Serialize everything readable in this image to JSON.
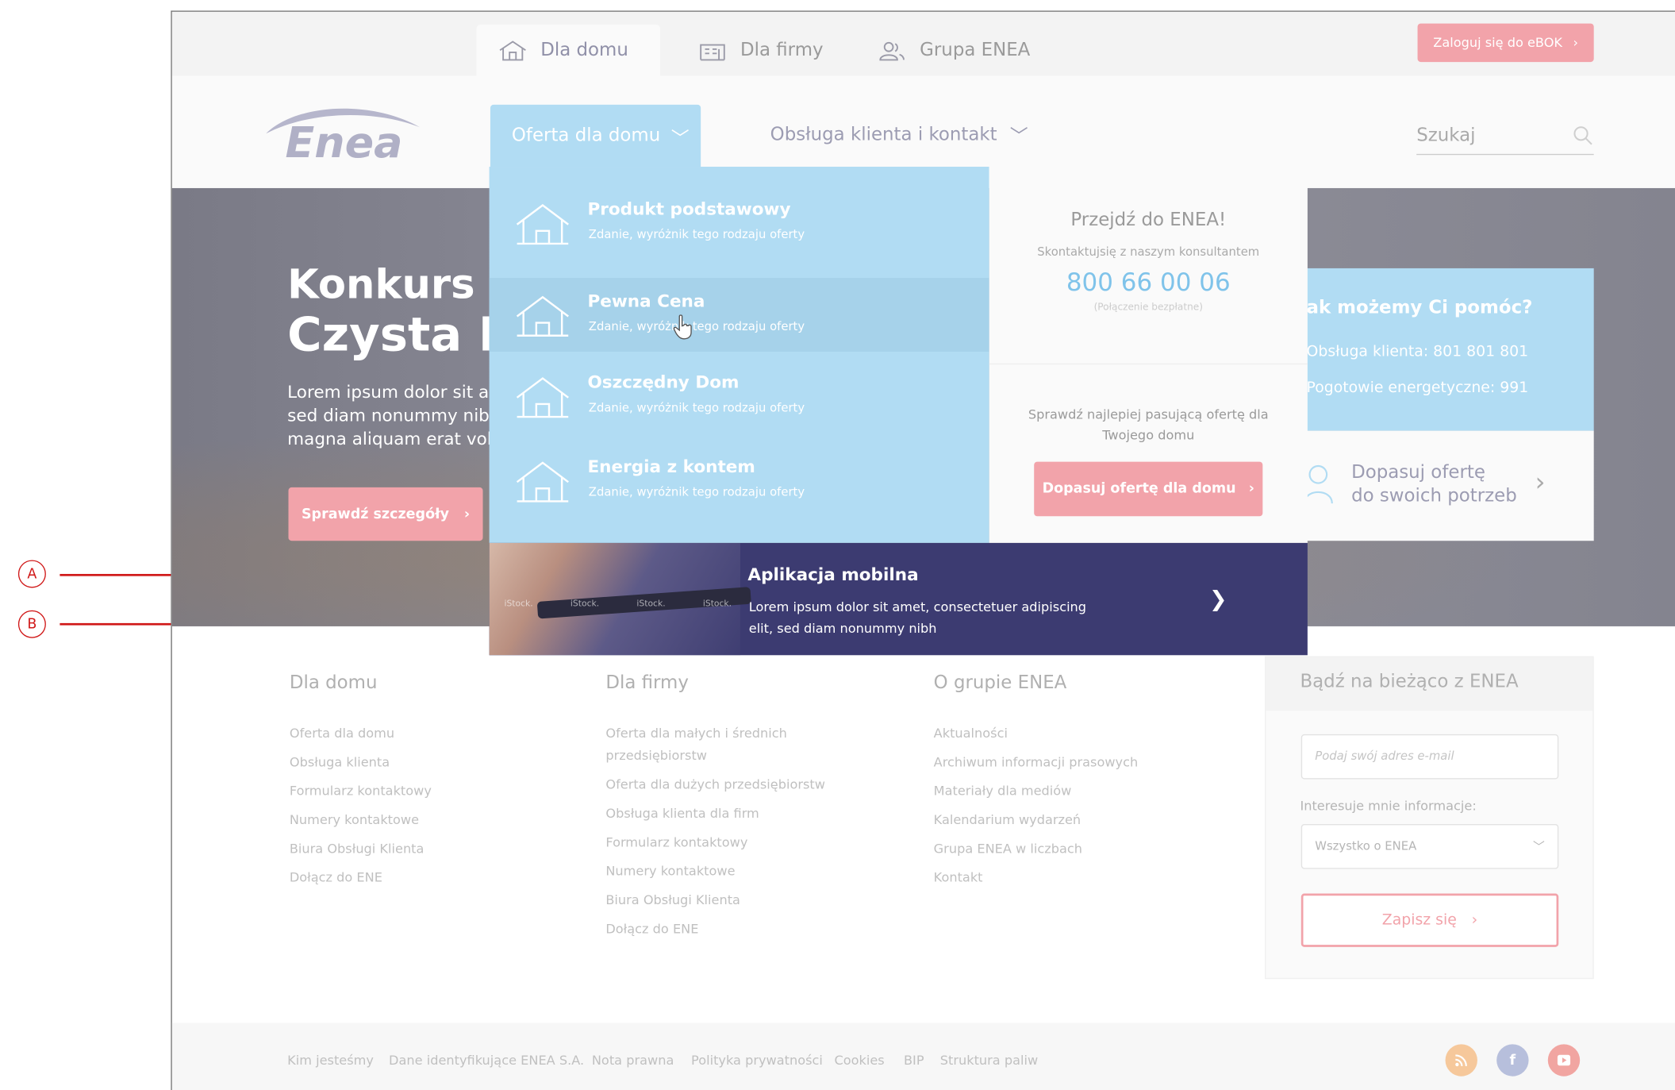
{
  "top_tabs": [
    {
      "label": "Dla domu",
      "icon": "house-icon"
    },
    {
      "label": "Dla firmy",
      "icon": "building-icon"
    },
    {
      "label": "Grupa ENEA",
      "icon": "people-icon"
    }
  ],
  "login_label": "Zaloguj się do eBOK",
  "logo_text": "Enea",
  "nav": {
    "oferta_label": "Oferta dla domu",
    "obsluga_label": "Obsługa klienta i kontakt",
    "search_placeholder": "Szukaj"
  },
  "hero": {
    "title1": "Konkurs",
    "title2": "Czysta E",
    "text": "Lorem ipsum dolor sit ar\nsed diam nonummy nibh\nmagna aliquam erat vol",
    "button_label": "Sprawdź szczegóły"
  },
  "help": {
    "title": "ak możemy Ci pomóc?",
    "line1": "Obsługa klienta: 801 801 801",
    "line2": "Pogotowie energetyczne: 991",
    "adjust_text": "Dopasuj ofertę\ndo swoich potrzeb"
  },
  "dropdown": {
    "items": [
      {
        "title": "Produkt podstawowy",
        "subtitle": "Zdanie, wyróżnik tego rodzaju oferty"
      },
      {
        "title": "Pewna Cena",
        "subtitle": "Zdanie, wyróżnik tego rodzaju oferty"
      },
      {
        "title": "Oszczędny Dom",
        "subtitle": "Zdanie, wyróżnik tego rodzaju oferty"
      },
      {
        "title": "Energia z kontem",
        "subtitle": "Zdanie, wyróżnik tego rodzaju oferty"
      }
    ],
    "go_title": "Przejdź do ENEA!",
    "contact_text": "Skontaktujsię z naszym konsultantem",
    "phone": "800 66 00 06",
    "free_text": "(Połączenie bezpłatne)",
    "match_text": "Sprawdź najlepiej pasującą ofertę dla Twojego domu",
    "match_button": "Dopasuj ofertę dla domu"
  },
  "app_banner": {
    "title": "Aplikacja mobilna",
    "description": "Lorem ipsum dolor sit amet, consectetuer adipiscing elit, sed diam nonummy nibh",
    "watermark": "iStock."
  },
  "footer": {
    "col1": {
      "title": "Dla domu",
      "links": [
        "Oferta dla domu",
        "Obsługa klienta",
        "Formularz kontaktowy",
        "Numery kontaktowe",
        "Biura Obsługi Klienta",
        "Dołącz do ENE"
      ]
    },
    "col2": {
      "title": "Dla firmy",
      "links": [
        "Oferta dla małych i średnich\nprzedsiębiorstw",
        "Oferta dla dużych przedsiębiorstw",
        "Obsługa klienta dla firm",
        "Formularz kontaktowy",
        "Numery kontaktowe",
        "Biura Obsługi Klienta",
        "Dołącz do ENE"
      ]
    },
    "col3": {
      "title": "O grupie ENEA",
      "links": [
        "Aktualności",
        "Archiwum informacji prasowych",
        "Materiały dla mediów",
        "Kalendarium wydarzeń",
        "Grupa ENEA w liczbach",
        "Kontakt"
      ]
    }
  },
  "newsletter": {
    "title": "Bądź na bieżąco z ENEA",
    "email_placeholder": "Podaj swój adres e-mail",
    "interest_label": "Interesuje mnie informacje:",
    "select_value": "Wszystko o ENEA",
    "submit_label": "Zapisz się"
  },
  "bottom_links": [
    "Kim jesteśmy",
    "Dane identyfikujące ENEA S.A.",
    "Nota prawna",
    "Polityka prywatności",
    "Cookies",
    "BIP",
    "Struktura paliw"
  ],
  "social": [
    {
      "icon": "rss-icon",
      "color": "#f6c89b"
    },
    {
      "icon": "facebook-icon",
      "color": "#b7bfdc"
    },
    {
      "icon": "youtube-icon",
      "color": "#f1a5a1"
    }
  ],
  "annotations": [
    "A",
    "B"
  ],
  "colors": {
    "accent_blue": "#b1dcf3",
    "accent_pink": "#f2a3aa",
    "banner_navy": "#3c3b71",
    "annotation_red": "#d01818"
  }
}
